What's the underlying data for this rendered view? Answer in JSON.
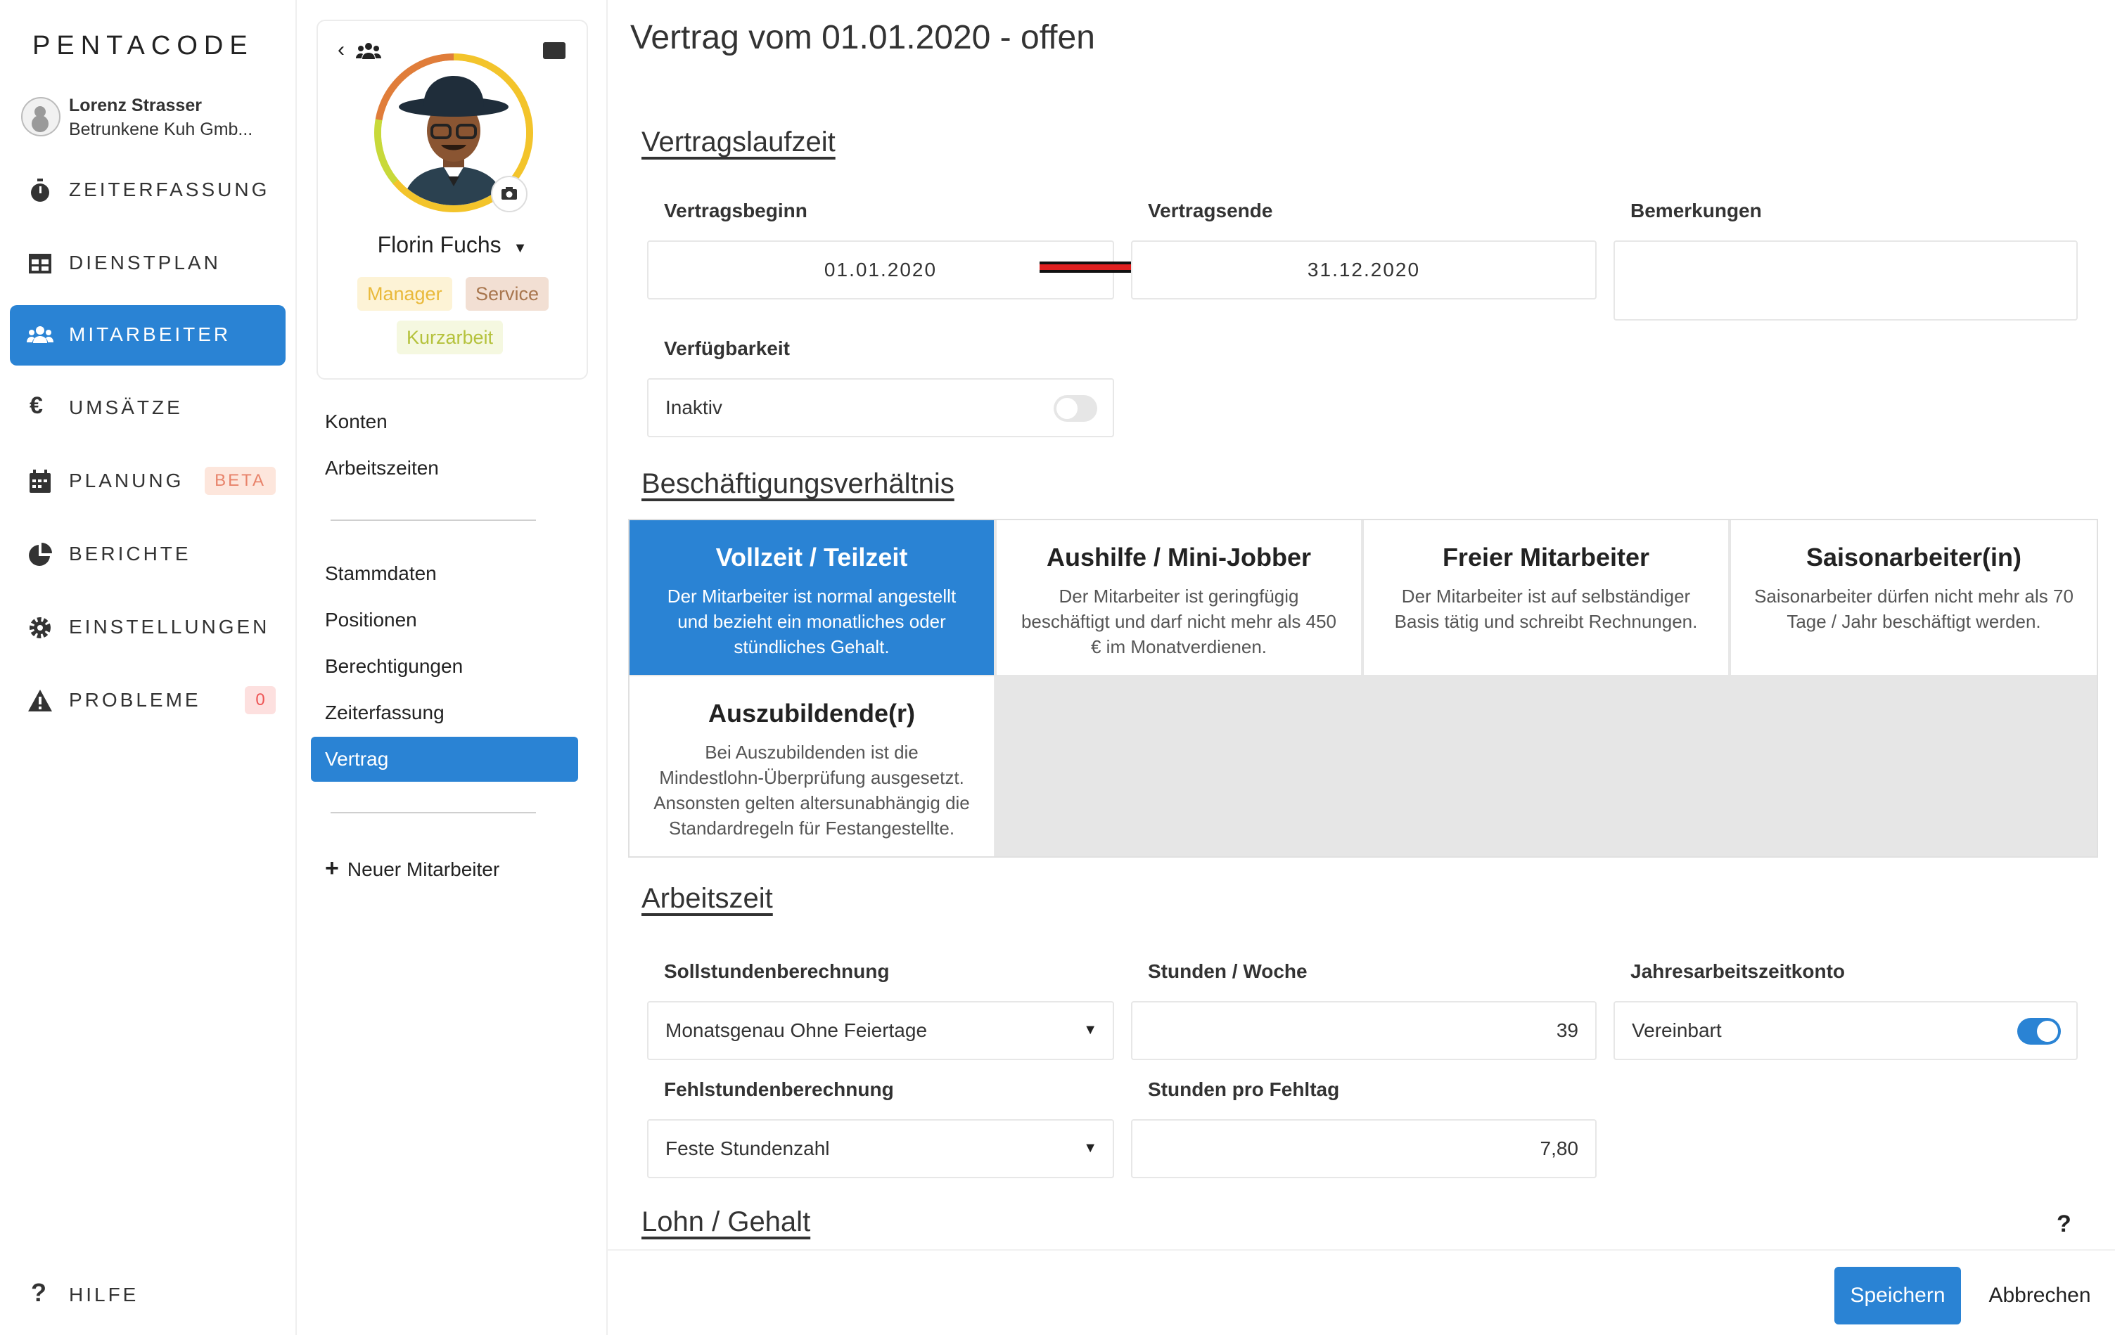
{
  "brand": "PENTACODE",
  "user": {
    "name": "Lorenz Strasser",
    "company": "Betrunkene Kuh Gmb..."
  },
  "nav": {
    "items": [
      {
        "label": "ZEITERFASSUNG",
        "icon": "stopwatch-icon"
      },
      {
        "label": "DIENSTPLAN",
        "icon": "table-icon"
      },
      {
        "label": "MITARBEITER",
        "icon": "users-icon",
        "active": true
      },
      {
        "label": "UMSÄTZE",
        "icon": "euro-icon"
      },
      {
        "label": "PLANUNG",
        "icon": "calendar-icon",
        "badge": "BETA"
      },
      {
        "label": "BERICHTE",
        "icon": "pie-chart-icon"
      },
      {
        "label": "EINSTELLUNGEN",
        "icon": "gear-icon"
      },
      {
        "label": "PROBLEME",
        "icon": "warning-icon",
        "badge": "0"
      }
    ],
    "help": "HILFE"
  },
  "employee": {
    "name": "Florin Fuchs",
    "tags": [
      "Manager",
      "Service",
      "Kurzarbeit"
    ],
    "links_top": [
      "Konten",
      "Arbeitszeiten"
    ],
    "links_main": [
      "Stammdaten",
      "Positionen",
      "Berechtigungen",
      "Zeiterfassung",
      "Vertrag"
    ],
    "active_link": "Vertrag",
    "new_employee": "Neuer Mitarbeiter"
  },
  "page": {
    "title": "Vertrag vom 01.01.2020 - offen",
    "sections": {
      "laufzeit": "Vertragslaufzeit",
      "beschaeftigung": "Beschäftigungsverhältnis",
      "arbeitszeit": "Arbeitszeit",
      "lohn": "Lohn / Gehalt"
    },
    "laufzeit": {
      "begin_label": "Vertragsbeginn",
      "begin_value": "01.01.2020",
      "end_label": "Vertragsende",
      "end_value": "31.12.2020",
      "remarks_label": "Bemerkungen",
      "remarks_value": "",
      "availability_label": "Verfügbarkeit",
      "availability_value": "Inaktiv",
      "availability_on": false
    },
    "types": [
      {
        "title": "Vollzeit / Teilzeit",
        "desc": "Der Mitarbeiter ist normal angestellt und bezieht ein monatliches oder stündliches Gehalt.",
        "selected": true
      },
      {
        "title": "Aushilfe / Mini-Jobber",
        "desc": "Der Mitarbeiter ist geringfügig beschäftigt und darf nicht mehr als 450 € im Monatverdienen."
      },
      {
        "title": "Freier Mitarbeiter",
        "desc": "Der Mitarbeiter ist auf selbständiger Basis tätig und schreibt Rechnungen."
      },
      {
        "title": "Saisonarbeiter(in)",
        "desc": "Saisonarbeiter dürfen nicht mehr als 70 Tage / Jahr beschäftigt werden."
      },
      {
        "title": "Auszubildende(r)",
        "desc": "Bei Auszubildenden ist die Mindestlohn-Überprüfung ausgesetzt. Ansonsten gelten altersunabhängig die Standardregeln für Festangestellte."
      }
    ],
    "arbeitszeit": {
      "soll_label": "Sollstundenberechnung",
      "soll_value": "Monatsgenau Ohne Feiertage",
      "week_label": "Stunden / Woche",
      "week_value": "39",
      "jahres_label": "Jahresarbeitszeitkonto",
      "jahres_value": "Vereinbart",
      "jahres_on": true,
      "fehl_label": "Fehlstundenberechnung",
      "fehl_value": "Feste Stundenzahl",
      "fehltag_label": "Stunden pro Fehltag",
      "fehltag_value": "7,80"
    },
    "help_mark": "?",
    "save": "Speichern",
    "cancel": "Abbrechen"
  },
  "colors": {
    "accent": "#2a83d4",
    "arrow": "#e02020"
  }
}
